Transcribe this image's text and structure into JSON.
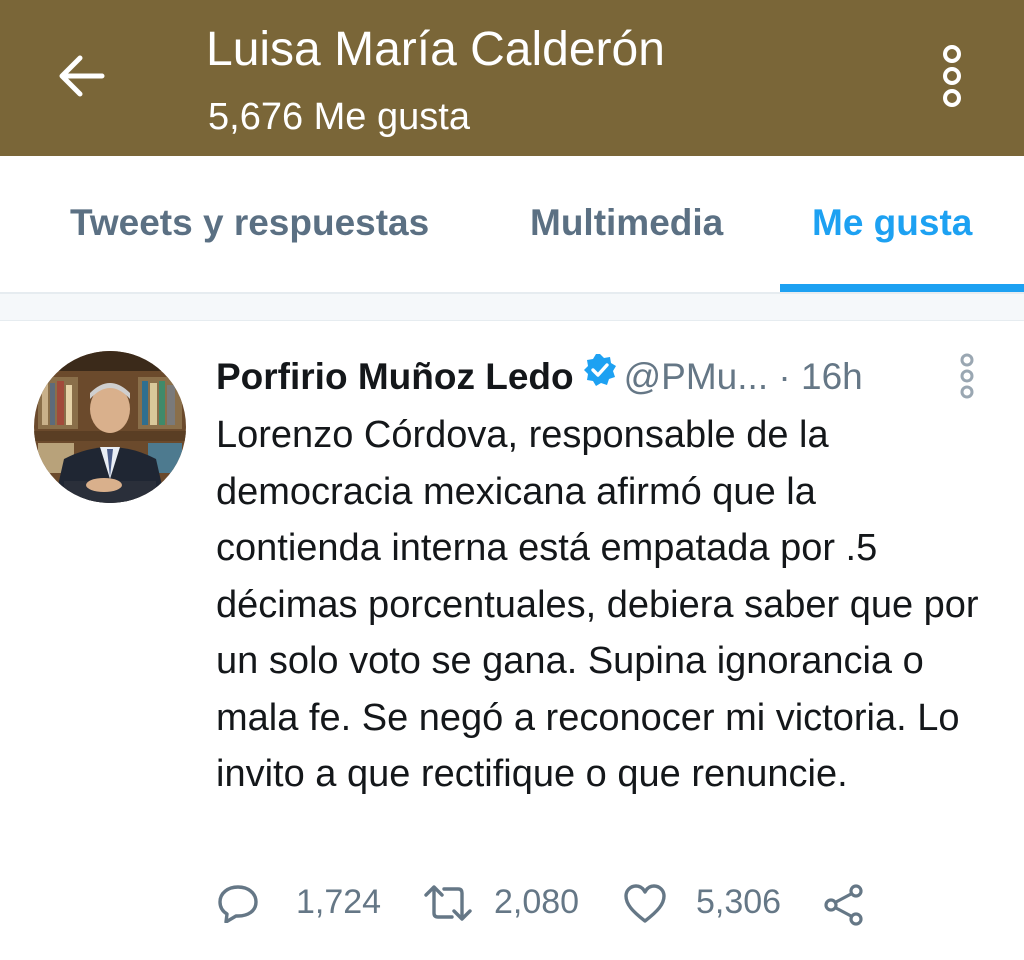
{
  "header": {
    "title": "Luisa María Calderón",
    "subtitle": "5,676 Me gusta",
    "background": "#7a6638"
  },
  "tabs": [
    {
      "label": "Tweets y respuestas",
      "active": false
    },
    {
      "label": "Multimedia",
      "active": false
    },
    {
      "label": "Me gusta",
      "active": true
    }
  ],
  "tweet": {
    "author": "Porfirio Muñoz Ledo",
    "verified": true,
    "handle": "@PMu...",
    "separator": "·",
    "time": "16h",
    "text": "Lorenzo Córdova, responsable de la democracia mexicana afirmó que la contienda interna está empatada por .5 décimas porcentuales, debiera saber que por un solo voto se gana. Supina ignorancia o mala fe. Se negó a reconocer mi victoria. Lo invito a que rectifique o que renuncie.",
    "replies": "1,724",
    "retweets": "2,080",
    "likes": "5,306"
  },
  "icons": {
    "back": "arrow-left-icon",
    "more": "more-vertical-icon",
    "verified": "verified-badge-icon",
    "caret": "more-vertical-icon",
    "reply": "reply-icon",
    "retweet": "retweet-icon",
    "like": "heart-icon",
    "share": "share-icon"
  },
  "colors": {
    "accent": "#1da1f2",
    "muted": "#657786",
    "text": "#14171a"
  }
}
